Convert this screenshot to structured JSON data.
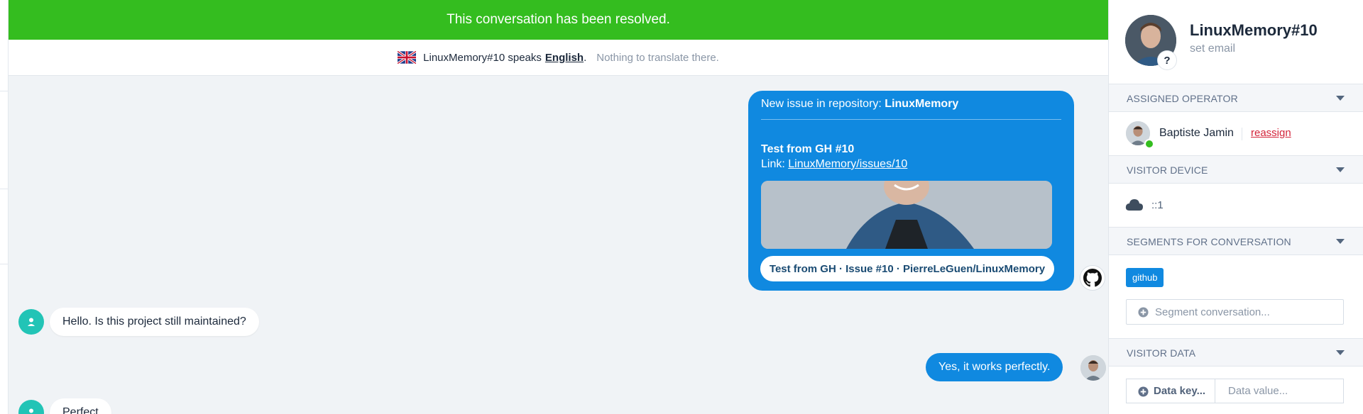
{
  "banner": {
    "text": "This conversation has been resolved."
  },
  "translation": {
    "speaker_text": "LinuxMemory#10 speaks",
    "language": "English",
    "period": ".",
    "hint": "Nothing to translate there."
  },
  "github_card": {
    "title_prefix": "New issue in repository: ",
    "repo": "LinuxMemory",
    "issue_title": "Test from GH #10",
    "link_prefix": "Link: ",
    "link_text": "LinuxMemory/issues/10",
    "cta": "Test from GH · Issue #10 · PierreLeGuen/LinuxMemory"
  },
  "messages": [
    {
      "from": "visitor",
      "text": "Hello. Is this project still maintained?"
    },
    {
      "from": "operator",
      "text": "Yes, it works perfectly."
    },
    {
      "from": "visitor",
      "text": "Perfect"
    }
  ],
  "sidebar": {
    "profile": {
      "name": "LinuxMemory#10",
      "email_placeholder": "set email",
      "badge": "?"
    },
    "sections": {
      "assigned_operator": "ASSIGNED OPERATOR",
      "visitor_device": "VISITOR DEVICE",
      "segments": "SEGMENTS FOR CONVERSATION",
      "visitor_data": "VISITOR DATA"
    },
    "operator": {
      "name": "Baptiste Jamin",
      "reassign": "reassign",
      "status": "online"
    },
    "device": {
      "ip": "::1",
      "icon": "cloud-icon"
    },
    "segments": {
      "tags": [
        "github"
      ],
      "input_placeholder": "Segment conversation..."
    },
    "visitor_data": {
      "key_placeholder": "Data key...",
      "value_placeholder": "Data value..."
    }
  },
  "colors": {
    "resolved": "#34bd1f",
    "accent": "#1089e0",
    "danger": "#d3243a",
    "visitor_avatar": "#22c4b6"
  }
}
